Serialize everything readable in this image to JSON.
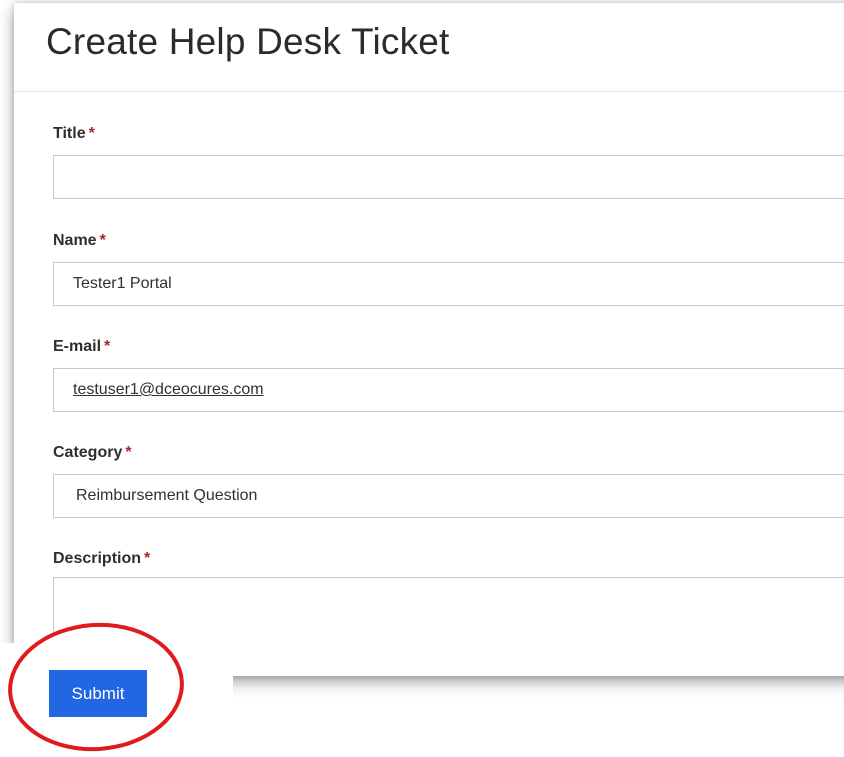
{
  "page": {
    "title": "Create Help Desk Ticket"
  },
  "form": {
    "required_marker": "*",
    "fields": {
      "title": {
        "label": "Title",
        "value": ""
      },
      "name": {
        "label": "Name",
        "value": "Tester1 Portal"
      },
      "email": {
        "label": "E-mail",
        "value": "testuser1@dceocures.com"
      },
      "category": {
        "label": "Category",
        "value": "Reimbursement Question"
      },
      "description": {
        "label": "Description",
        "value": ""
      }
    },
    "submit_label": "Submit"
  },
  "annotation": {
    "color": "#e01b1b",
    "shape": "circle",
    "target": "submit-button"
  },
  "theme": {
    "primary": "#2266e3",
    "required": "#a4262c"
  }
}
